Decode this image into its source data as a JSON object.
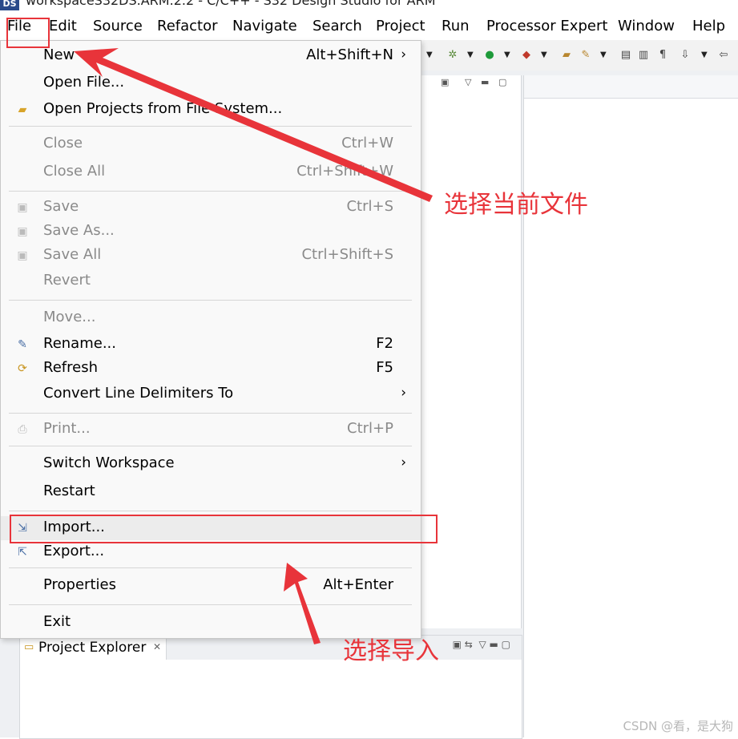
{
  "window": {
    "icon_text": "DS",
    "title": "workspaceS32DS.ARM.2.2 - C/C++ - S32 Design Studio for ARM"
  },
  "menubar": {
    "items": [
      "File",
      "Edit",
      "Source",
      "Refactor",
      "Navigate",
      "Search",
      "Project",
      "Run",
      "Processor Expert",
      "Window",
      "Help"
    ]
  },
  "file_menu": {
    "new": {
      "label": "New",
      "accel": "Alt+Shift+N"
    },
    "open_file": {
      "label": "Open File..."
    },
    "open_projects": {
      "label": "Open Projects from File System..."
    },
    "close": {
      "label": "Close",
      "accel": "Ctrl+W"
    },
    "close_all": {
      "label": "Close All",
      "accel": "Ctrl+Shift+W"
    },
    "save": {
      "label": "Save",
      "accel": "Ctrl+S"
    },
    "save_as": {
      "label": "Save As..."
    },
    "save_all": {
      "label": "Save All",
      "accel": "Ctrl+Shift+S"
    },
    "revert": {
      "label": "Revert"
    },
    "move": {
      "label": "Move..."
    },
    "rename": {
      "label": "Rename...",
      "accel": "F2"
    },
    "refresh": {
      "label": "Refresh",
      "accel": "F5"
    },
    "convert": {
      "label": "Convert Line Delimiters To"
    },
    "print": {
      "label": "Print...",
      "accel": "Ctrl+P"
    },
    "switch_ws": {
      "label": "Switch Workspace"
    },
    "restart": {
      "label": "Restart"
    },
    "import": {
      "label": "Import..."
    },
    "export": {
      "label": "Export..."
    },
    "properties": {
      "label": "Properties",
      "accel": "Alt+Enter"
    },
    "exit": {
      "label": "Exit"
    }
  },
  "project_explorer": {
    "tab_label": "Project Explorer"
  },
  "annotations": {
    "select_current_file": "选择当前文件",
    "select_import": "选择导入",
    "color": "#e8343a"
  },
  "watermark": "CSDN @看，是大狗"
}
